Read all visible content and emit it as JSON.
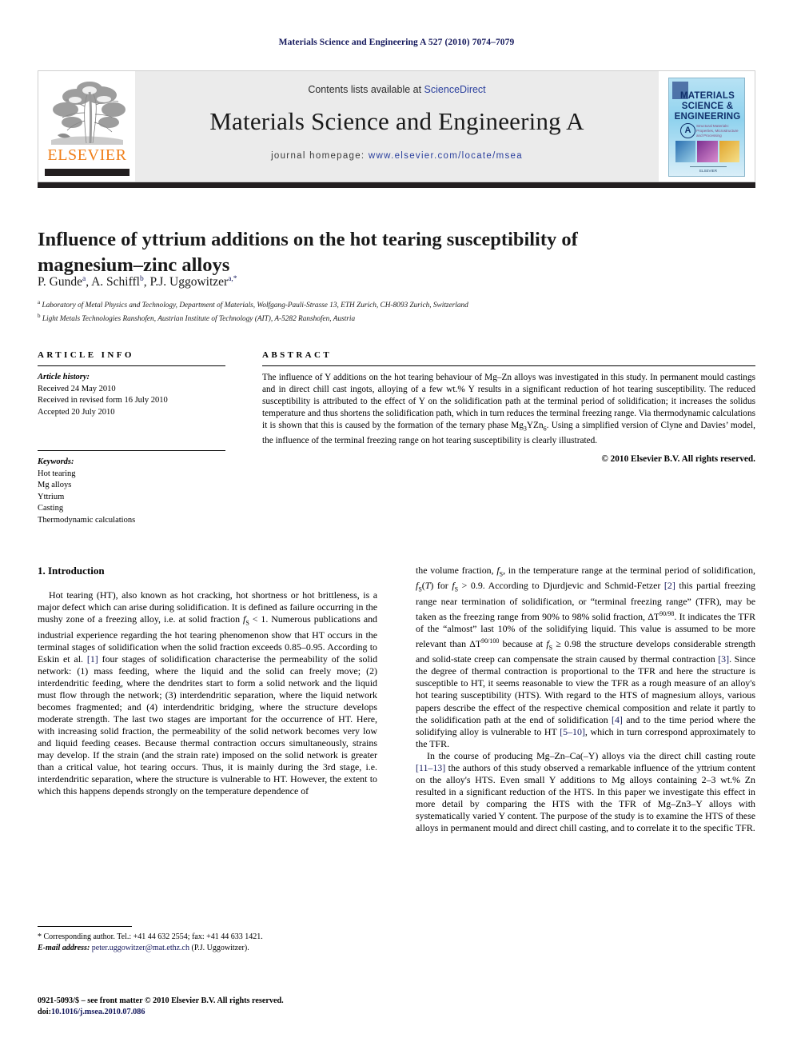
{
  "running_head": "Materials Science and Engineering A 527 (2010) 7074–7079",
  "masthead": {
    "publisher_logo_text": "ELSEVIER",
    "contents_prefix": "Contents lists available at ",
    "contents_link": "ScienceDirect",
    "journal_title": "Materials Science and Engineering A",
    "homepage_prefix": "journal homepage: ",
    "homepage_url": "www.elsevier.com/locate/msea",
    "cover": {
      "line1": "MATERIALS",
      "line2": "SCIENCE &",
      "line3": "ENGINEERING",
      "badge": "A",
      "subtitle": "Structural Materials: Properties, Microstructure and Processing",
      "footer": "ELSEVIER"
    }
  },
  "article": {
    "title": "Influence of yttrium additions on the hot tearing susceptibility of magnesium–zinc alloys",
    "authors_html": "P. Gunde<sup>a</sup>, A. Schiffl<sup>b</sup>, P.J. Uggowitzer<sup>a,*</sup>",
    "affiliation_a": "Laboratory of Metal Physics and Technology, Department of Materials, Wolfgang-Pauli-Strasse 13, ETH Zurich, CH-8093 Zurich, Switzerland",
    "affiliation_b": "Light Metals Technologies Ranshofen, Austrian Institute of Technology (AIT), A-5282 Ranshofen, Austria"
  },
  "article_info": {
    "heading": "ARTICLE INFO",
    "history_label": "Article history:",
    "received": "Received 24 May 2010",
    "revised": "Received in revised form 16 July 2010",
    "accepted": "Accepted 20 July 2010",
    "keywords_label": "Keywords:",
    "keywords": [
      "Hot tearing",
      "Mg alloys",
      "Yttrium",
      "Casting",
      "Thermodynamic calculations"
    ]
  },
  "abstract": {
    "heading": "ABSTRACT",
    "text": "The influence of Y additions on the hot tearing behaviour of Mg–Zn alloys was investigated in this study. In permanent mould castings and in direct chill cast ingots, alloying of a few wt.% Y results in a significant reduction of hot tearing susceptibility. The reduced susceptibility is attributed to the effect of Y on the solidification path at the terminal period of solidification; it increases the solidus temperature and thus shortens the solidification path, which in turn reduces the terminal freezing range. Via thermodynamic calculations it is shown that this is caused by the formation of the ternary phase Mg3YZn6. Using a simplified version of Clyne and Davies’ model, the influence of the terminal freezing range on hot tearing susceptibility is clearly illustrated.",
    "copyright": "© 2010 Elsevier B.V. All rights reserved."
  },
  "body": {
    "section1_heading": "1. Introduction",
    "left_p1": "Hot tearing (HT), also known as hot cracking, hot shortness or hot brittleness, is a major defect which can arise during solidification. It is defined as failure occurring in the mushy zone of a freezing alloy, i.e. at solid fraction fS < 1. Numerous publications and industrial experience regarding the hot tearing phenomenon show that HT occurs in the terminal stages of solidification when the solid fraction exceeds 0.85–0.95. According to Eskin et al. [1] four stages of solidification characterise the permeability of the solid network: (1) mass feeding, where the liquid and the solid can freely move; (2) interdendritic feeding, where the dendrites start to form a solid network and the liquid must flow through the network; (3) interdendritic separation, where the liquid network becomes fragmented; and (4) interdendritic bridging, where the structure develops moderate strength. The last two stages are important for the occurrence of HT. Here, with increasing solid fraction, the permeability of the solid network becomes very low and liquid feeding ceases. Because thermal contraction occurs simultaneously, strains may develop. If the strain (and the strain rate) imposed on the solid network is greater than a critical value, hot tearing occurs. Thus, it is mainly during the 3rd stage, i.e. interdendritic separation, where the structure is vulnerable to HT. However, the extent to which this happens depends strongly on the temperature dependence of",
    "right_p1": "the volume fraction, fS, in the temperature range at the terminal period of solidification, fS(T) for fS > 0.9. According to Djurdjevic and Schmid-Fetzer [2] this partial freezing range near termination of solidification, or “terminal freezing range” (TFR), may be taken as the freezing range from 90% to 98% solid fraction, ΔT90/98. It indicates the TFR of the “almost” last 10% of the solidifying liquid. This value is assumed to be more relevant than ΔT90/100 because at fS ≥ 0.98 the structure develops considerable strength and solid-state creep can compensate the strain caused by thermal contraction [3]. Since the degree of thermal contraction is proportional to the TFR and here the structure is susceptible to HT, it seems reasonable to view the TFR as a rough measure of an alloy's hot tearing susceptibility (HTS). With regard to the HTS of magnesium alloys, various papers describe the effect of the respective chemical composition and relate it partly to the solidification path at the end of solidification [4] and to the time period where the solidifying alloy is vulnerable to HT [5–10], which in turn correspond approximately to the TFR.",
    "right_p2": "In the course of producing Mg–Zn–Ca(–Y) alloys via the direct chill casting route [11–13] the authors of this study observed a remarkable influence of the yttrium content on the alloy's HTS. Even small Y additions to Mg alloys containing 2–3 wt.% Zn resulted in a significant reduction of the HTS. In this paper we investigate this effect in more detail by comparing the HTS with the TFR of Mg–Zn3–Y alloys with systematically varied Y content. The purpose of the study is to examine the HTS of these alloys in permanent mould and direct chill casting, and to correlate it to the specific TFR."
  },
  "footnote": {
    "corresponding": "* Corresponding author. Tel.: +41 44 632 2554; fax: +41 44 633 1421.",
    "email_label": "E-mail address:",
    "email": "peter.uggowitzer@mat.ethz.ch",
    "email_owner": "(P.J. Uggowitzer)."
  },
  "imprint": {
    "issn_line": "0921-5093/$ – see front matter © 2010 Elsevier B.V. All rights reserved.",
    "doi_label": "doi:",
    "doi": "10.1016/j.msea.2010.07.086"
  },
  "colors": {
    "link": "#2a3f9d",
    "reference": "#14185c",
    "elsevier_orange": "#f07f1a",
    "rule_dark": "#231f20",
    "masthead_bg": "#ebebeb"
  }
}
